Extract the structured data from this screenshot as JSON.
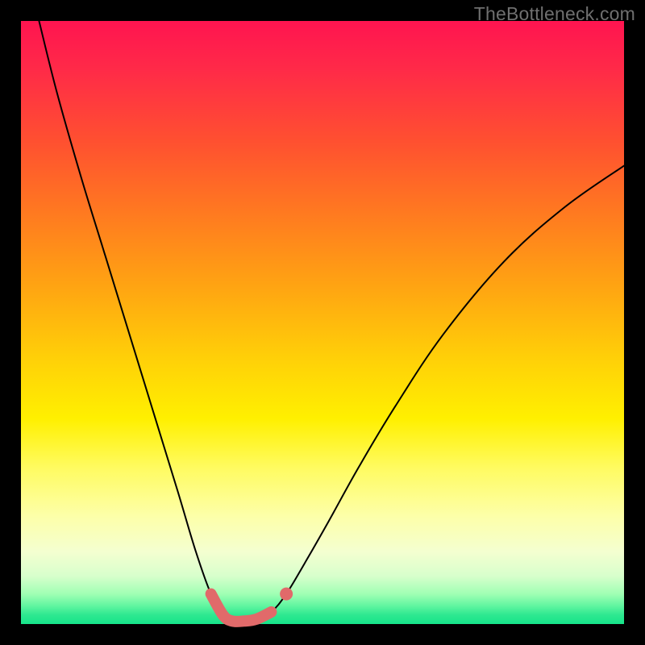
{
  "watermark": "TheBottleneck.com",
  "chart_data": {
    "type": "line",
    "title": "",
    "xlabel": "",
    "ylabel": "",
    "xlim": [
      0,
      100
    ],
    "ylim": [
      0,
      100
    ],
    "series": [
      {
        "name": "bottleneck-curve",
        "x": [
          3,
          6,
          10,
          14,
          18,
          22,
          26,
          29,
          31.5,
          33.5,
          35,
          37,
          39,
          41.5,
          44,
          47,
          51,
          56,
          62,
          70,
          80,
          90,
          100
        ],
        "y": [
          100,
          88,
          74,
          61,
          48,
          35,
          22,
          12,
          5,
          1.5,
          0.5,
          0.5,
          0.8,
          2,
          5,
          10,
          17,
          26,
          36,
          48,
          60,
          69,
          76
        ]
      }
    ],
    "highlight": {
      "name": "optimal-range",
      "x": [
        31.5,
        33.5,
        35,
        37,
        39,
        41.5
      ],
      "y": [
        5,
        1.5,
        0.5,
        0.5,
        0.8,
        2
      ]
    },
    "marker": {
      "x": 44,
      "y": 5
    },
    "background_gradient": {
      "top": "#ff1450",
      "mid": "#fff000",
      "bottom": "#16e48a"
    }
  }
}
